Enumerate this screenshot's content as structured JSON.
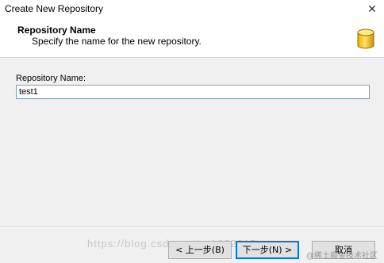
{
  "window": {
    "title": "Create New Repository",
    "close_glyph": "✕"
  },
  "header": {
    "title": "Repository Name",
    "subtitle": "Specify the name for the new repository.",
    "icon": "database-icon"
  },
  "form": {
    "label": "Repository Name:",
    "value": "test1"
  },
  "buttons": {
    "back_label": "< 上一步(B)",
    "next_label": "下一步(N) >",
    "cancel_label": "取消"
  },
  "watermark": {
    "url_text": "https://blog.csdn.net/...16?2015",
    "logo_text": "@稀土掘金技术社区"
  }
}
